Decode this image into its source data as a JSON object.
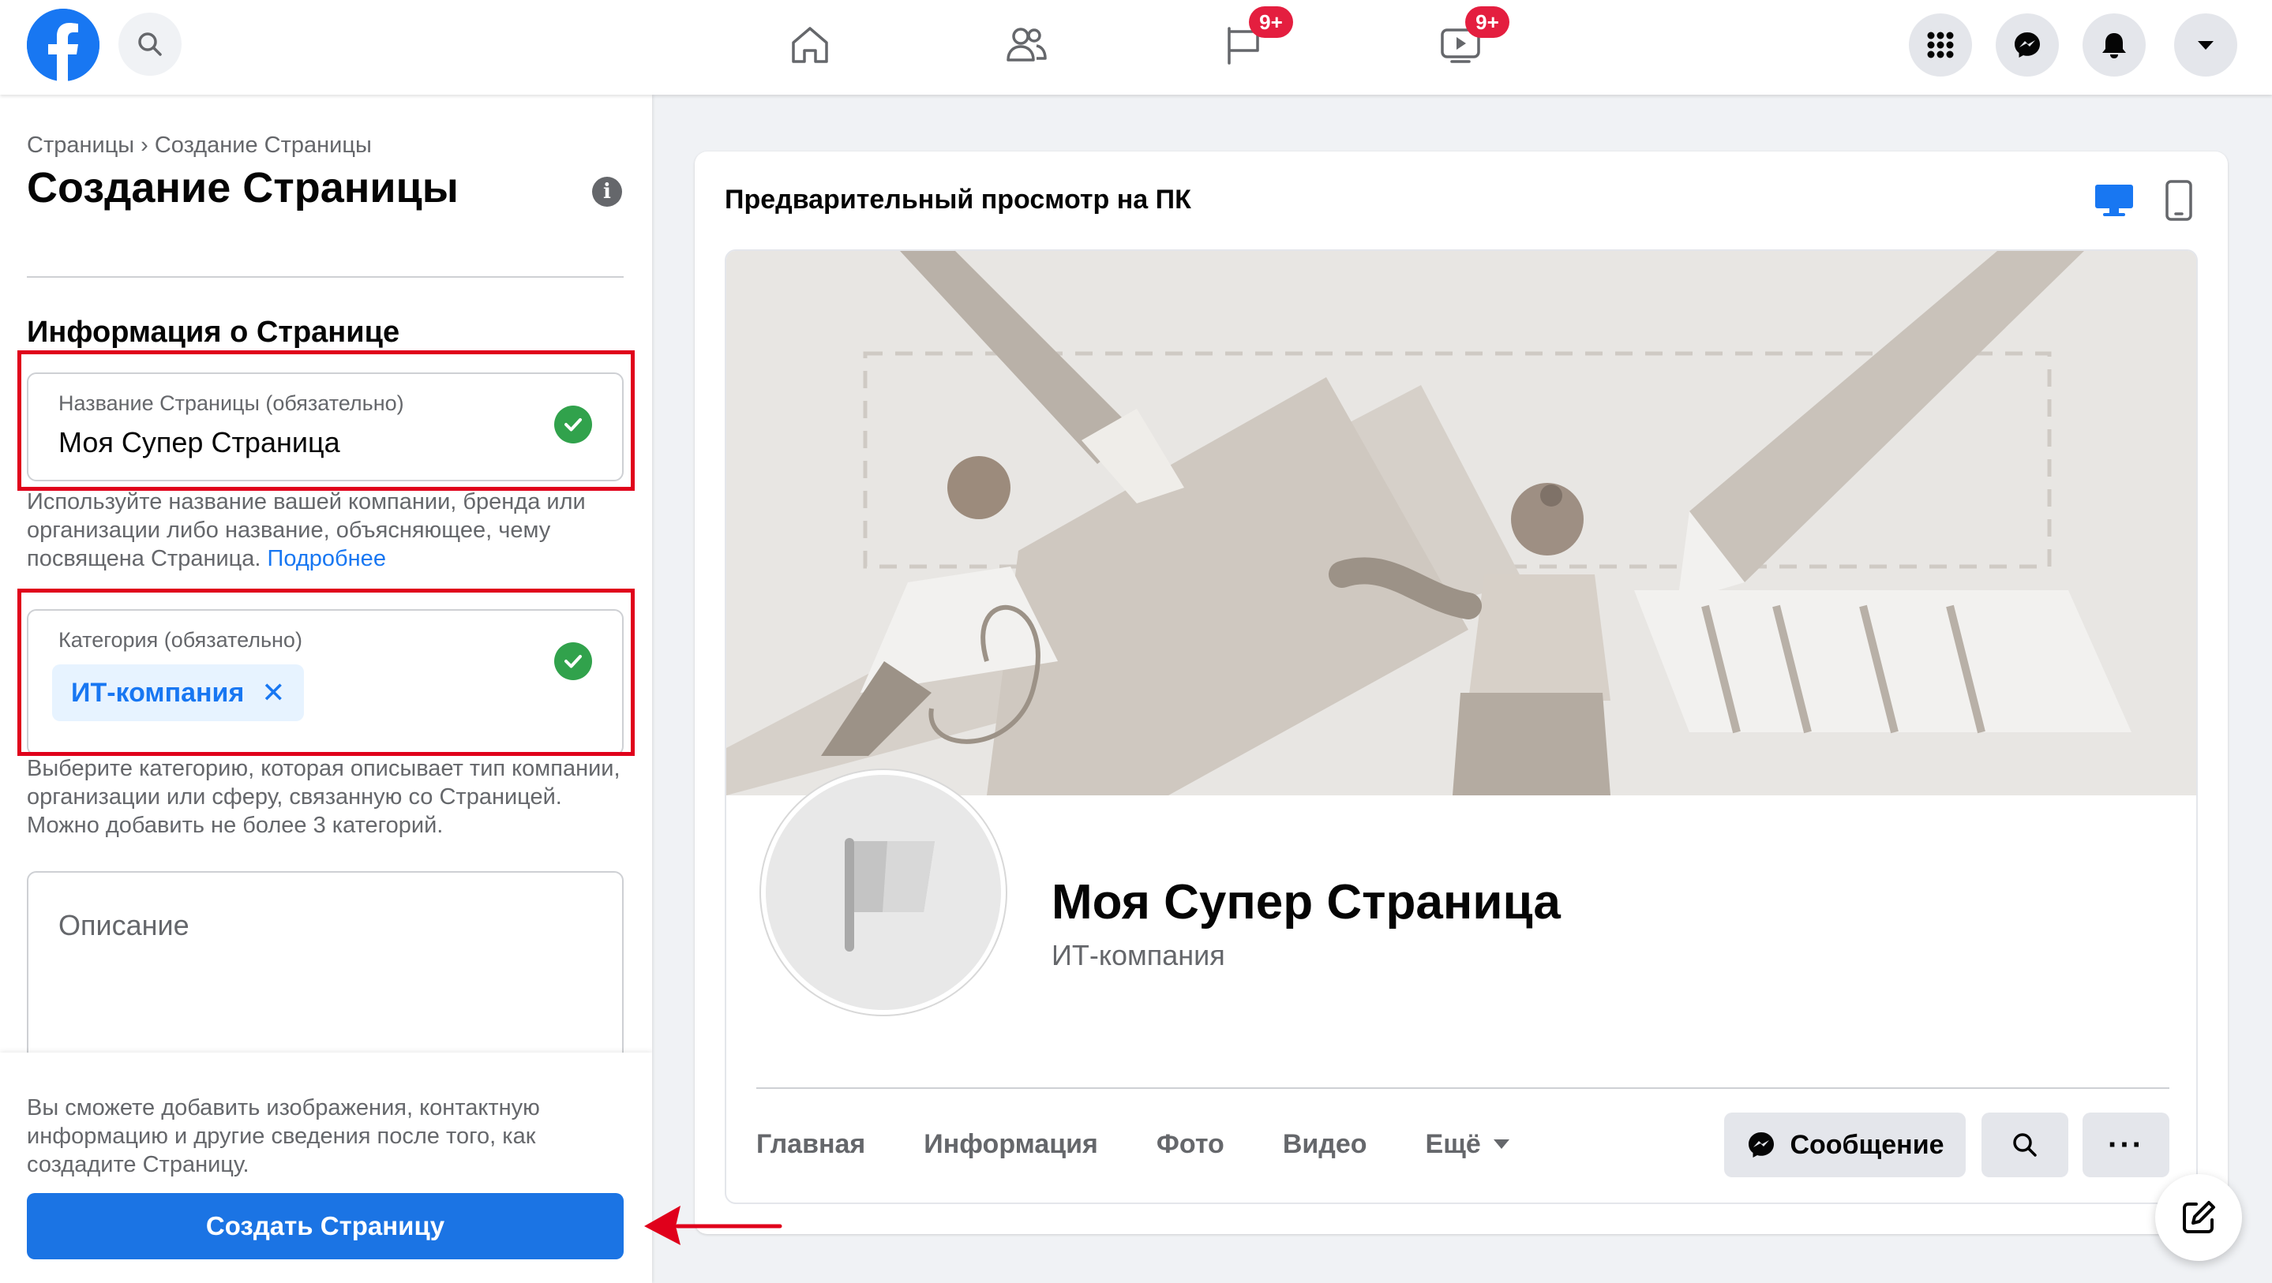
{
  "topbar": {
    "badges": {
      "pages": "9+",
      "watch": "9+"
    }
  },
  "left": {
    "breadcrumb": {
      "parent": "Страницы",
      "separator": "›",
      "current": "Создание Страницы"
    },
    "title": "Создание Страницы",
    "section_title": "Информация о Странице",
    "name_field": {
      "label": "Название Страницы (обязательно)",
      "value": "Моя Супер Страница"
    },
    "name_helper": "Используйте название вашей компании, бренда или организации либо название, объясняющее, чему посвящена Страница.",
    "name_helper_link": "Подробнее",
    "category_field": {
      "label": "Категория (обязательно)",
      "chip": "ИТ-компания",
      "chip_remove": "✕"
    },
    "category_helper": "Выберите категорию, которая описывает тип компании, организации или сферу, связанную со Страницей. Можно добавить не более 3 категорий.",
    "description_field": {
      "placeholder": "Описание"
    },
    "bottom_note": "Вы сможете добавить изображения, контактную информацию и другие сведения после того, как создадите Страницу.",
    "create_button": "Создать Страницу"
  },
  "preview": {
    "title": "Предварительный просмотр на ПК",
    "page_name": "Моя Супер Страница",
    "page_category": "ИТ-компания",
    "tabs": [
      "Главная",
      "Информация",
      "Фото",
      "Видео",
      "Ещё"
    ],
    "message_button": "Сообщение",
    "more_button": "···"
  },
  "colors": {
    "brand": "#1877f2",
    "highlight": "#e0001b",
    "success": "#31a24c",
    "badge": "#e41e3f"
  }
}
